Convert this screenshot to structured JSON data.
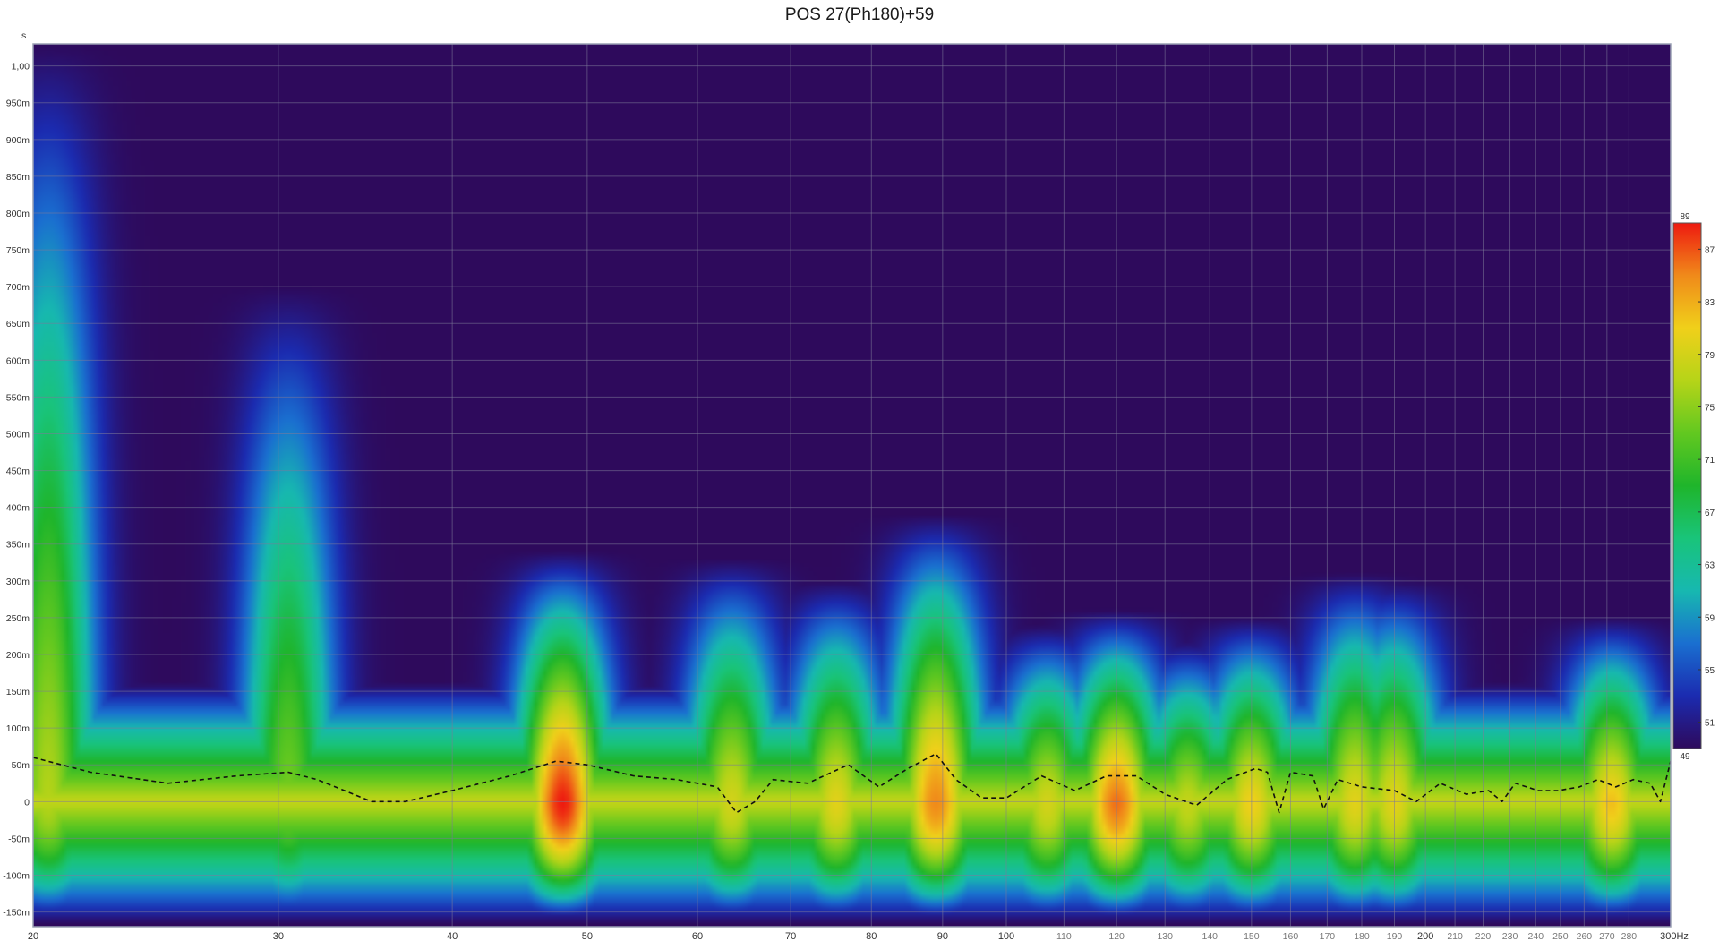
{
  "chart_data": {
    "type": "heatmap",
    "title": "POS 27(Ph180)+59",
    "y_unit_label": "s",
    "x_unit_label": "Hz",
    "x_scale": "log",
    "xlim": [
      20,
      300
    ],
    "ylim": [
      -0.17,
      1.03
    ],
    "x_ticks": [
      {
        "value": 20,
        "label": "20",
        "major": true
      },
      {
        "value": 30,
        "label": "30",
        "major": true
      },
      {
        "value": 40,
        "label": "40",
        "major": true
      },
      {
        "value": 50,
        "label": "50",
        "major": true
      },
      {
        "value": 60,
        "label": "60",
        "major": true
      },
      {
        "value": 70,
        "label": "70",
        "major": true
      },
      {
        "value": 80,
        "label": "80",
        "major": true
      },
      {
        "value": 90,
        "label": "90",
        "major": true
      },
      {
        "value": 100,
        "label": "100",
        "major": true
      },
      {
        "value": 110,
        "label": "110",
        "major": false
      },
      {
        "value": 120,
        "label": "120",
        "major": false
      },
      {
        "value": 130,
        "label": "130",
        "major": false
      },
      {
        "value": 140,
        "label": "140",
        "major": false
      },
      {
        "value": 150,
        "label": "150",
        "major": false
      },
      {
        "value": 160,
        "label": "160",
        "major": false
      },
      {
        "value": 170,
        "label": "170",
        "major": false
      },
      {
        "value": 180,
        "label": "180",
        "major": false
      },
      {
        "value": 190,
        "label": "190",
        "major": false
      },
      {
        "value": 200,
        "label": "200",
        "major": true
      },
      {
        "value": 210,
        "label": "210",
        "major": false
      },
      {
        "value": 220,
        "label": "220",
        "major": false
      },
      {
        "value": 230,
        "label": "230",
        "major": false
      },
      {
        "value": 240,
        "label": "240",
        "major": false
      },
      {
        "value": 250,
        "label": "250",
        "major": false
      },
      {
        "value": 260,
        "label": "260",
        "major": false
      },
      {
        "value": 270,
        "label": "270",
        "major": false
      },
      {
        "value": 280,
        "label": "280",
        "major": false
      }
    ],
    "x_end_label": "300Hz",
    "y_ticks": [
      {
        "value": 1.0,
        "label": "1,00"
      },
      {
        "value": 0.95,
        "label": "950m"
      },
      {
        "value": 0.9,
        "label": "900m"
      },
      {
        "value": 0.85,
        "label": "850m"
      },
      {
        "value": 0.8,
        "label": "800m"
      },
      {
        "value": 0.75,
        "label": "750m"
      },
      {
        "value": 0.7,
        "label": "700m"
      },
      {
        "value": 0.65,
        "label": "650m"
      },
      {
        "value": 0.6,
        "label": "600m"
      },
      {
        "value": 0.55,
        "label": "550m"
      },
      {
        "value": 0.5,
        "label": "500m"
      },
      {
        "value": 0.45,
        "label": "450m"
      },
      {
        "value": 0.4,
        "label": "400m"
      },
      {
        "value": 0.35,
        "label": "350m"
      },
      {
        "value": 0.3,
        "label": "300m"
      },
      {
        "value": 0.25,
        "label": "250m"
      },
      {
        "value": 0.2,
        "label": "200m"
      },
      {
        "value": 0.15,
        "label": "150m"
      },
      {
        "value": 0.1,
        "label": "100m"
      },
      {
        "value": 0.05,
        "label": "50m"
      },
      {
        "value": 0.0,
        "label": "0"
      },
      {
        "value": -0.05,
        "label": "-50m"
      },
      {
        "value": -0.1,
        "label": "-100m"
      },
      {
        "value": -0.15,
        "label": "-150m"
      }
    ],
    "grid": true,
    "background_color": "#2e0a5c",
    "colorbar": {
      "min": 49,
      "max": 89,
      "tick_labels": [
        "89",
        "87",
        "83",
        "79",
        "75",
        "71",
        "67",
        "63",
        "59",
        "55",
        "51",
        "49"
      ],
      "tick_values": [
        89,
        87,
        83,
        79,
        75,
        71,
        67,
        63,
        59,
        55,
        51,
        49
      ],
      "placement": "right",
      "stops": [
        {
          "value": 49,
          "color": "#2e0a5c"
        },
        {
          "value": 53,
          "color": "#1b2bb0"
        },
        {
          "value": 57,
          "color": "#1a6fd0"
        },
        {
          "value": 61,
          "color": "#17b8b0"
        },
        {
          "value": 65,
          "color": "#19c47a"
        },
        {
          "value": 69,
          "color": "#1fb52b"
        },
        {
          "value": 73,
          "color": "#62c820"
        },
        {
          "value": 77,
          "color": "#b6d418"
        },
        {
          "value": 81,
          "color": "#f0d01a"
        },
        {
          "value": 85,
          "color": "#f08a1a"
        },
        {
          "value": 89,
          "color": "#ee1a10"
        }
      ]
    },
    "decay_ridges": [
      {
        "f": 20.5,
        "t_top": 1.03,
        "peak_db": 77
      },
      {
        "f": 30.5,
        "t_top": 0.7,
        "peak_db": 74
      },
      {
        "f": 48,
        "t_top": 0.34,
        "peak_db": 89
      },
      {
        "f": 63.5,
        "t_top": 0.33,
        "peak_db": 79
      },
      {
        "f": 75.5,
        "t_top": 0.3,
        "peak_db": 80
      },
      {
        "f": 89,
        "t_top": 0.39,
        "peak_db": 85
      },
      {
        "f": 107,
        "t_top": 0.24,
        "peak_db": 79
      },
      {
        "f": 120,
        "t_top": 0.26,
        "peak_db": 86
      },
      {
        "f": 135,
        "t_top": 0.22,
        "peak_db": 78
      },
      {
        "f": 150,
        "t_top": 0.25,
        "peak_db": 81
      },
      {
        "f": 178,
        "t_top": 0.31,
        "peak_db": 80
      },
      {
        "f": 190,
        "t_top": 0.3,
        "peak_db": 80
      },
      {
        "f": 272,
        "t_top": 0.25,
        "peak_db": 82
      }
    ],
    "series": [
      {
        "style": "dashed",
        "color": "#111111",
        "points": [
          [
            20,
            0.06
          ],
          [
            22,
            0.04
          ],
          [
            25,
            0.025
          ],
          [
            28,
            0.035
          ],
          [
            30.5,
            0.04
          ],
          [
            32,
            0.03
          ],
          [
            35,
            0.0
          ],
          [
            37,
            0.0
          ],
          [
            40,
            0.015
          ],
          [
            44,
            0.035
          ],
          [
            47.5,
            0.055
          ],
          [
            50,
            0.05
          ],
          [
            54,
            0.035
          ],
          [
            58,
            0.03
          ],
          [
            62,
            0.02
          ],
          [
            64,
            -0.015
          ],
          [
            66,
            0.0
          ],
          [
            68,
            0.03
          ],
          [
            72,
            0.025
          ],
          [
            77,
            0.05
          ],
          [
            81,
            0.02
          ],
          [
            85,
            0.045
          ],
          [
            89,
            0.065
          ],
          [
            92,
            0.03
          ],
          [
            96,
            0.005
          ],
          [
            100,
            0.005
          ],
          [
            106,
            0.035
          ],
          [
            112,
            0.015
          ],
          [
            118,
            0.035
          ],
          [
            124,
            0.035
          ],
          [
            130,
            0.01
          ],
          [
            137,
            -0.005
          ],
          [
            144,
            0.03
          ],
          [
            151,
            0.045
          ],
          [
            154,
            0.04
          ],
          [
            157,
            -0.015
          ],
          [
            160,
            0.04
          ],
          [
            166,
            0.035
          ],
          [
            169,
            -0.01
          ],
          [
            173,
            0.03
          ],
          [
            180,
            0.02
          ],
          [
            190,
            0.015
          ],
          [
            197,
            0.0
          ],
          [
            205,
            0.025
          ],
          [
            214,
            0.01
          ],
          [
            222,
            0.015
          ],
          [
            227,
            0.0
          ],
          [
            232,
            0.025
          ],
          [
            241,
            0.015
          ],
          [
            249,
            0.015
          ],
          [
            258,
            0.02
          ],
          [
            266,
            0.03
          ],
          [
            274,
            0.02
          ],
          [
            282,
            0.03
          ],
          [
            290,
            0.025
          ],
          [
            295,
            0.0
          ],
          [
            300,
            0.055
          ]
        ]
      }
    ]
  }
}
